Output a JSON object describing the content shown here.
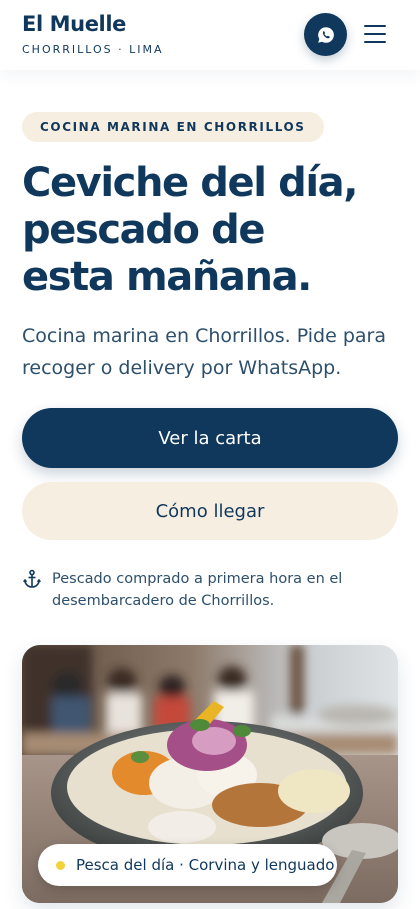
{
  "brand": {
    "name": "El Muelle",
    "location": "CHORRILLOS · LIMA"
  },
  "header": {
    "whatsapp_icon": "whatsapp-icon",
    "menu_icon": "hamburger-menu-icon"
  },
  "hero": {
    "eyebrow": "COCINA MARINA EN CHORRILLOS",
    "headline": [
      "Ceviche del día,",
      "pescado de",
      "esta mañana."
    ],
    "lead": "Cocina marina en Chorrillos. Pide para recoger o delivery por WhatsApp."
  },
  "actions": {
    "primary_label": "Ver la carta",
    "secondary_label": "Cómo llegar"
  },
  "note": {
    "icon": "anchor-icon",
    "text": "Pescado comprado a primera hora en el desembarcadero de Chorrillos."
  },
  "photo": {
    "badge": "Pesca del día · Corvina y lenguado"
  },
  "colors": {
    "navy": "#10385c",
    "cream": "#f6eee1",
    "dot": "#f2d33a"
  }
}
